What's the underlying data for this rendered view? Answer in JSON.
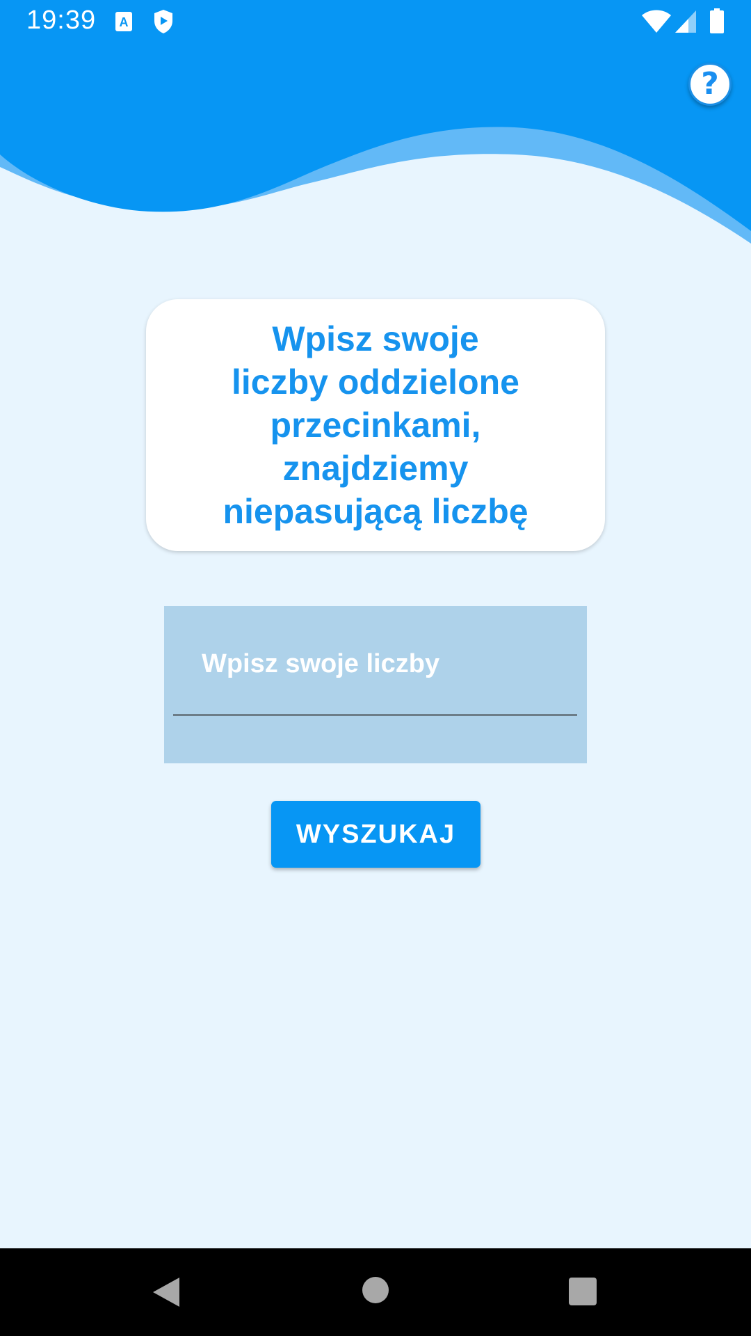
{
  "status_bar": {
    "time": "19:39",
    "icons": [
      "text-a-icon",
      "shield-play-icon",
      "wifi-icon",
      "signal-icon",
      "battery-icon"
    ]
  },
  "header": {
    "help_label": "?"
  },
  "main": {
    "title": "Wpisz swoje\nliczby oddzielone\nprzecinkami,\nznajdziemy\nniepasującą liczbę",
    "input": {
      "placeholder": "Wpisz swoje liczby",
      "value": ""
    },
    "search_button_label": "WYSZUKAJ"
  },
  "nav": {
    "buttons": [
      "back-icon",
      "home-icon",
      "recents-icon"
    ]
  },
  "colors": {
    "primary": "#0796f4",
    "wave_light": "#62b9f7",
    "background": "#e8f5fe",
    "input_fill": "#aed2ea",
    "title_text": "#1693ee"
  }
}
